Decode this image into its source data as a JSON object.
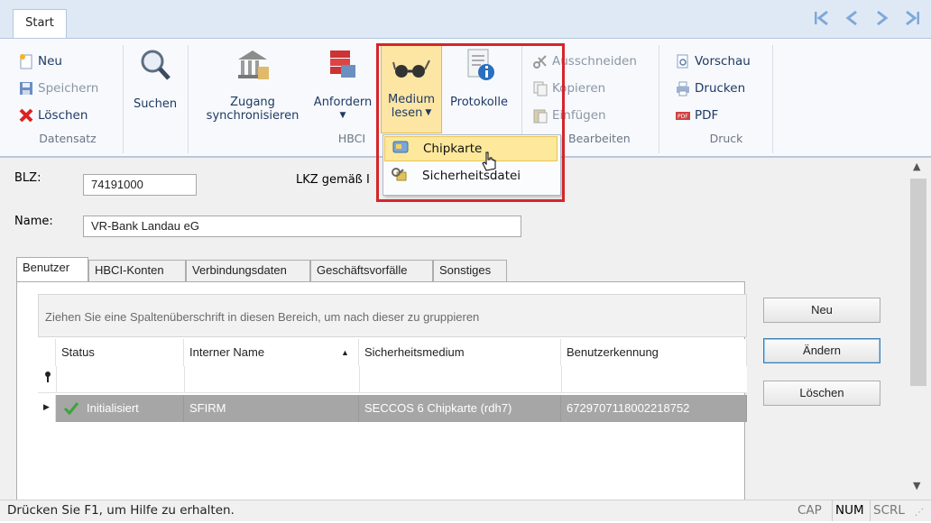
{
  "tabs": {
    "start": "Start"
  },
  "nav": {
    "first": "|<",
    "prev": "<",
    "next": ">",
    "last": ">|"
  },
  "ribbon": {
    "datensatz": {
      "neu": "Neu",
      "speichern": "Speichern",
      "loeschen": "Löschen",
      "label": "Datensatz"
    },
    "suchen": "Suchen",
    "zugang": {
      "line1": "Zugang",
      "line2": "synchronisieren"
    },
    "anfordern": "Anfordern",
    "hbci_label": "HBCI",
    "medium": {
      "line1": "Medium",
      "line2": "lesen"
    },
    "protokolle": "Protokolle",
    "bearbeiten": {
      "ausschneiden": "Ausschneiden",
      "kopieren": "Kopieren",
      "einfuegen": "Einfügen",
      "label": "Bearbeiten"
    },
    "druck": {
      "vorschau": "Vorschau",
      "drucken": "Drucken",
      "pdf": "PDF",
      "label": "Druck"
    }
  },
  "dropdown": {
    "chipkarte": "Chipkarte",
    "sicherheitsdatei": "Sicherheitsdatei"
  },
  "form": {
    "blz_label": "BLZ:",
    "blz_value": "74191000",
    "lkz_label": "LKZ gemäß I",
    "name_label": "Name:",
    "name_value": "VR-Bank Landau eG"
  },
  "content_tabs": [
    "Benutzer",
    "HBCI-Konten",
    "Verbindungsdaten",
    "Geschäftsvorfälle",
    "Sonstiges"
  ],
  "grid": {
    "group_hint": "Ziehen Sie eine Spaltenüberschrift in diesen Bereich, um nach dieser zu gruppieren",
    "columns": [
      "Status",
      "Interner Name",
      "Sicherheitsmedium",
      "Benutzerkennung"
    ],
    "row": {
      "status": "Initialisiert",
      "intern": "SFIRM",
      "medium": "SECCOS 6 Chipkarte (rdh7)",
      "kennung": "6729707118002218752"
    }
  },
  "side_buttons": {
    "neu": "Neu",
    "aendern": "Ändern",
    "loeschen": "Löschen"
  },
  "status": {
    "text": "Drücken Sie F1, um Hilfe zu erhalten.",
    "cap": "CAP",
    "num": "NUM",
    "scrl": "SCRL"
  }
}
